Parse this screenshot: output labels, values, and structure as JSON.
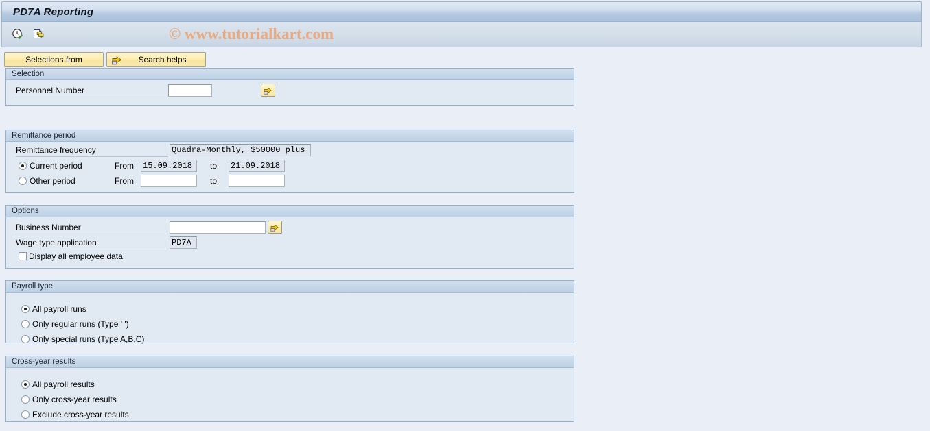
{
  "window": {
    "title": "PD7A Reporting"
  },
  "watermark": {
    "text": "© www.tutorialkart.com"
  },
  "toolbar": {
    "icons": [
      {
        "name": "execute-clock-icon",
        "title": "Execute with variant"
      },
      {
        "name": "copy-document-icon",
        "title": "Get variant"
      }
    ]
  },
  "buttons": {
    "selections_from": "Selections from",
    "search_helps": "Search helps"
  },
  "sections": {
    "selection": {
      "title": "Selection",
      "personnel_number": {
        "label": "Personnel Number",
        "value": "",
        "placeholder": ""
      },
      "multiple_selection_icon": "multiple-selection-arrow-icon"
    },
    "remittance_period": {
      "title": "Remittance period",
      "frequency": {
        "label": "Remittance frequency",
        "value": "Quadra-Monthly, $50000 plus"
      },
      "current_period": {
        "label": "Current period",
        "selected": true,
        "from_label": "From",
        "from_value": "15.09.2018",
        "to_label": "to",
        "to_value": "21.09.2018"
      },
      "other_period": {
        "label": "Other period",
        "selected": false,
        "from_label": "From",
        "from_value": "",
        "to_label": "to",
        "to_value": ""
      }
    },
    "options": {
      "title": "Options",
      "business_number": {
        "label": "Business Number",
        "value": ""
      },
      "multiple_selection_icon": "multiple-selection-arrow-icon",
      "wage_type_application": {
        "label": "Wage type application",
        "value": "PD7A"
      },
      "display_all_employee_data": {
        "label": "Display all employee data",
        "checked": false
      }
    },
    "payroll_type": {
      "title": "Payroll type",
      "options": [
        {
          "label": "All payroll runs",
          "selected": true
        },
        {
          "label": "Only regular runs (Type ' ')",
          "selected": false
        },
        {
          "label": "Only special runs (Type A,B,C)",
          "selected": false
        }
      ]
    },
    "cross_year_results": {
      "title": "Cross-year results",
      "options": [
        {
          "label": "All payroll results",
          "selected": true
        },
        {
          "label": "Only cross-year results",
          "selected": false
        },
        {
          "label": "Exclude cross-year results",
          "selected": false
        }
      ]
    }
  },
  "colors": {
    "title_bar": "#b5c9e0",
    "panel_bg": "#e1e9f3",
    "panel_border": "#94b0cc",
    "button_yellow": "#fbecae",
    "watermark": "#eaa97f",
    "app_bg": "#eaeff7"
  }
}
